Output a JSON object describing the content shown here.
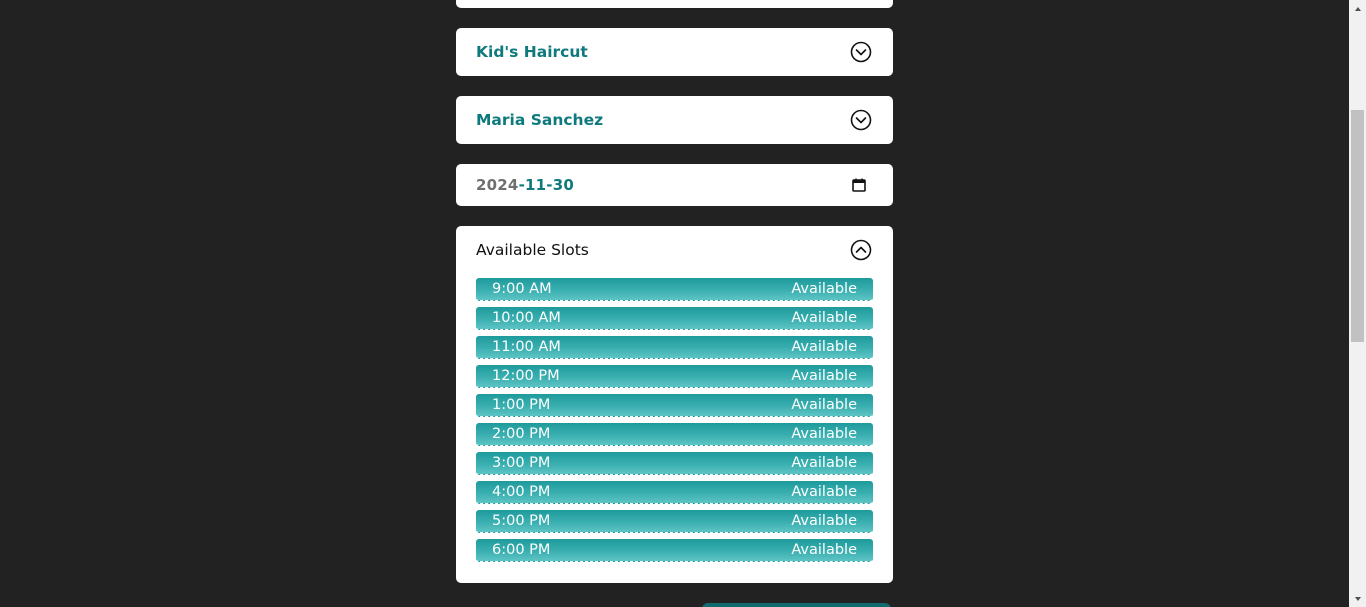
{
  "service_select": {
    "value": "Kid's Haircut"
  },
  "stylist_select": {
    "value": "Maria Sanchez"
  },
  "date_input": {
    "year": "2024",
    "rest": "-11-30"
  },
  "slots": {
    "title": "Available Slots",
    "items": [
      {
        "time": "9:00 AM",
        "status": "Available"
      },
      {
        "time": "10:00 AM",
        "status": "Available"
      },
      {
        "time": "11:00 AM",
        "status": "Available"
      },
      {
        "time": "12:00 PM",
        "status": "Available"
      },
      {
        "time": "1:00 PM",
        "status": "Available"
      },
      {
        "time": "2:00 PM",
        "status": "Available"
      },
      {
        "time": "3:00 PM",
        "status": "Available"
      },
      {
        "time": "4:00 PM",
        "status": "Available"
      },
      {
        "time": "5:00 PM",
        "status": "Available"
      },
      {
        "time": "6:00 PM",
        "status": "Available"
      }
    ]
  },
  "icons": {
    "select_chevron": "chevron-down-circle-icon",
    "slots_chevron": "chevron-up-circle-icon",
    "calendar": "calendar-icon"
  },
  "colors": {
    "background": "#222222",
    "accent": "#0f7a7e",
    "slot_top": "#1f9a9c",
    "slot_bottom": "#5ec4c4"
  }
}
